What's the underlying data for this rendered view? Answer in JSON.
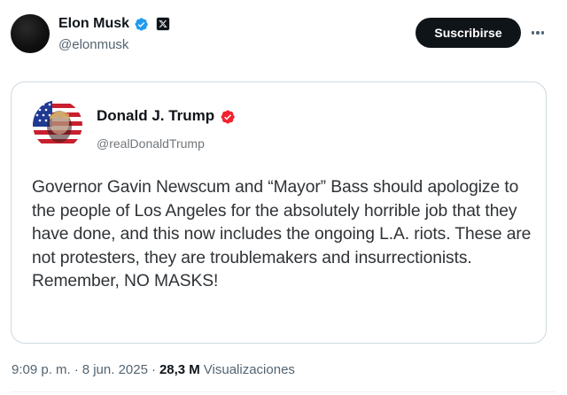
{
  "author": {
    "name": "Elon Musk",
    "handle": "@elonmusk",
    "verified_badge": "blue-verified-icon",
    "affiliation_badge": "x-logo-icon"
  },
  "actions": {
    "subscribe_label": "Suscribirse",
    "more_icon": "more-horizontal-icon"
  },
  "quoted_tweet": {
    "author_name": "Donald J. Trump",
    "author_handle": "@realDonaldTrump",
    "verified_badge": "red-verified-icon",
    "text": "Governor Gavin Newscum and “Mayor” Bass should apologize to the people of Los Angeles for the absolutely horrible job that they have done, and this now includes the ongoing L.A. riots. These are not protesters, they are troublemakers and insurrectionists. Remember, NO MASKS!"
  },
  "meta": {
    "time": "9:09 p. m.",
    "separator": "·",
    "date": "8 jun. 2025",
    "views_count": "28,3 M",
    "views_label": "Visualizaciones"
  },
  "colors": {
    "primary_text": "#0f1419",
    "secondary_text": "#536471",
    "verified_blue": "#1d9bf0",
    "verified_red": "#f4212e",
    "border": "#cfd9de"
  }
}
